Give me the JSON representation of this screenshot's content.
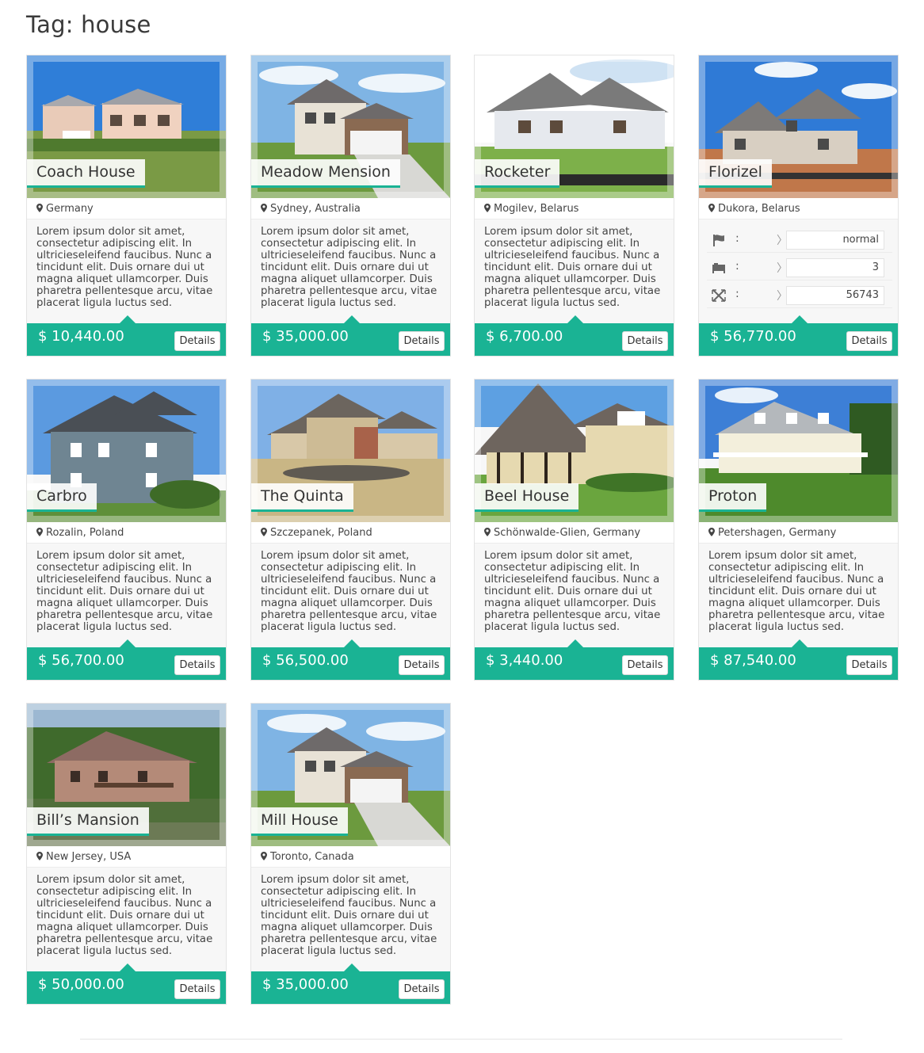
{
  "page": {
    "title": "Tag: house"
  },
  "description": "Lorem ipsum dolor sit amet, consectetur adipiscing elit. In ultricieseleifend faucibus. Nunc a tincidunt elit. Duis ornare dui ut magna aliquet ullamcorper. Duis pharetra pellentesque arcu, vitae placerat ligula luctus sed.",
  "details_label": "Details",
  "colors": {
    "accent": "#1ab394",
    "card_bg": "#f7f7f7"
  },
  "listings": [
    {
      "title": "Coach House",
      "location": "Germany",
      "price": "$ 10,440.00",
      "icon": "house-photo"
    },
    {
      "title": "Meadow Mension",
      "location": "Sydney, Australia",
      "price": "$ 35,000.00",
      "icon": "house-photo"
    },
    {
      "title": "Rocketer",
      "location": "Mogilev, Belarus",
      "price": "$ 6,700.00",
      "icon": "house-photo"
    },
    {
      "title": "Florizel",
      "location": "Dukora, Belarus",
      "price": "$ 56,770.00",
      "icon": "house-photo",
      "stats": [
        {
          "icon": "flag-icon",
          "label": ":",
          "value": "normal"
        },
        {
          "icon": "bed-icon",
          "label": ":",
          "value": "3"
        },
        {
          "icon": "area-icon",
          "label": ":",
          "value": "56743"
        }
      ]
    },
    {
      "title": "Carbro",
      "location": "Rozalin, Poland",
      "price": "$ 56,700.00",
      "icon": "house-photo"
    },
    {
      "title": "The Quinta",
      "location": "Szczepanek, Poland",
      "price": "$ 56,500.00",
      "icon": "house-photo"
    },
    {
      "title": "Beel House",
      "location": "Schönwalde-Glien, Germany",
      "price": "$ 3,440.00",
      "icon": "house-photo"
    },
    {
      "title": "Proton",
      "location": "Petershagen, Germany",
      "price": "$ 87,540.00",
      "icon": "house-photo"
    },
    {
      "title": "Bill’s Mansion",
      "location": "New Jersey, USA",
      "price": "$ 50,000.00",
      "icon": "house-photo"
    },
    {
      "title": "Mill House",
      "location": "Toronto, Canada",
      "price": "$ 35,000.00",
      "icon": "house-photo"
    }
  ]
}
